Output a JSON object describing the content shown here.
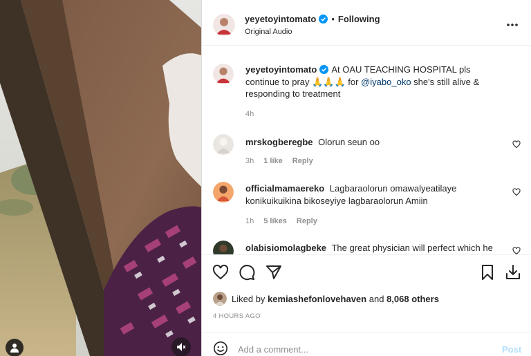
{
  "post": {
    "author": "yeyetoyintomato",
    "audio_label": "Original Audio",
    "follow_status": "Following",
    "separator": "•",
    "caption": {
      "username": "yeyetoyintomato",
      "text_before": "At OAU TEACHING HOSPITAL pls continue to pray 🙏🙏🙏 for ",
      "mention": "@iyabo_oko",
      "text_after": " she's still alive & responding to treatment",
      "time": "4h"
    },
    "comments": [
      {
        "username": "mrskogberegbe",
        "text": "Olorun seun oo",
        "time": "3h",
        "likes": "1 like",
        "reply": "Reply"
      },
      {
        "username": "officialmamaereko",
        "text": "Lagbaraolorun omawalyeatilaye konikuikuikina bikoseyiye lagbaraolorun Amiin",
        "time": "1h",
        "likes": "5 likes",
        "reply": "Reply"
      },
      {
        "username": "olabisiomolagbeke",
        "text": "The great physician will perfect which he"
      }
    ],
    "likes": {
      "prefix": "Liked by",
      "user": "kemiashefonlovehaven",
      "conj": "and",
      "others": "8,068 others"
    },
    "date": "4 HOURS AGO",
    "add_comment": {
      "placeholder": "Add a comment...",
      "post_label": "Post"
    }
  },
  "icons": {
    "more": "more-options-icon",
    "heart": "heart-icon",
    "comment": "comment-icon",
    "share": "share-icon",
    "save": "bookmark-icon",
    "download": "download-icon",
    "emoji": "emoji-icon",
    "user_tag": "user-tag-icon",
    "mute": "mute-icon",
    "verified": "verified-badge-icon"
  },
  "colors": {
    "verified": "#0095f6",
    "mention": "#00376b",
    "post_disabled": "#b2dffc",
    "meta": "#8e8e8e"
  }
}
